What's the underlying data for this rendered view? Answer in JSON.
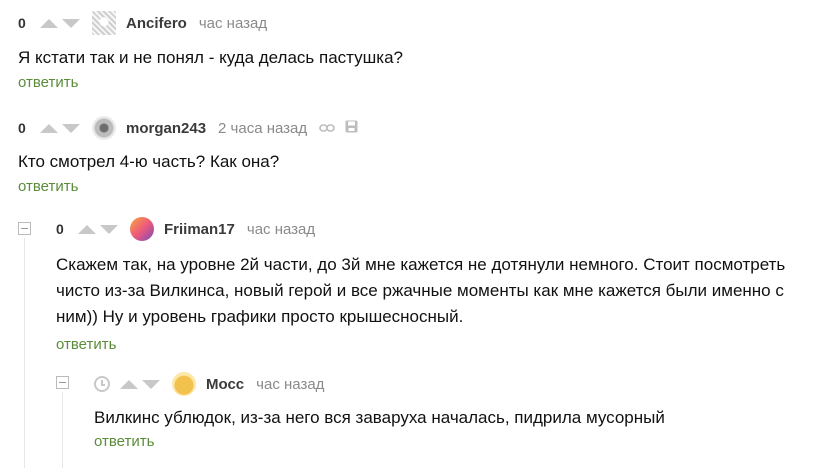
{
  "comments": [
    {
      "rating": "0",
      "author": "Ancifero",
      "time": "час назад",
      "text": "Я кстати так и не понял - куда делась пастушка?",
      "reply": "ответить"
    },
    {
      "rating": "0",
      "author": "morgan243",
      "time": "2 часа назад",
      "text": "Кто смотрел 4-ю часть? Как она?",
      "reply": "ответить"
    },
    {
      "rating": "0",
      "author": "Friiman17",
      "time": "час назад",
      "text": "Скажем так, на уровне 2й части, до 3й мне кажется не дотянули немного. Стоит посмотреть чисто из-за Вилкинса, новый герой и все ржачные моменты как мне кажется были именно с ним)) Ну и уровень графики просто крышесносный.",
      "reply": "ответить"
    },
    {
      "author": "Мосс",
      "time": "час назад",
      "text": "Вилкинс ублюдок, из-за него вся заваруха началась, пидрила мусорный",
      "reply": "ответить"
    }
  ],
  "icons": {
    "link": "link-icon",
    "save": "save-icon",
    "clock": "clock-icon"
  },
  "colors": {
    "reply_link": "#5b8c3a",
    "meta_text": "#8a8a8a",
    "vote_arrow": "#c8c8c8"
  }
}
